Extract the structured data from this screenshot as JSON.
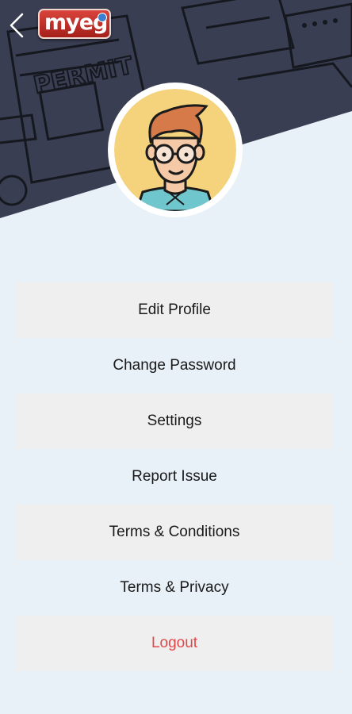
{
  "header": {
    "logo_text": "myeg",
    "banner_text": "PERMIT",
    "back_icon": "chevron-left-icon"
  },
  "menu": {
    "items": [
      {
        "label": "Edit Profile"
      },
      {
        "label": "Change Password"
      },
      {
        "label": "Settings"
      },
      {
        "label": "Report Issue"
      },
      {
        "label": "Terms & Conditions"
      },
      {
        "label": "Terms & Privacy"
      },
      {
        "label": "Logout"
      }
    ]
  },
  "colors": {
    "header_bg": "#3a3e52",
    "page_bg": "#e8f0f8",
    "shaded_row": "#efefef",
    "logout_red": "#e0484a",
    "avatar_bg": "#f5d27c"
  }
}
